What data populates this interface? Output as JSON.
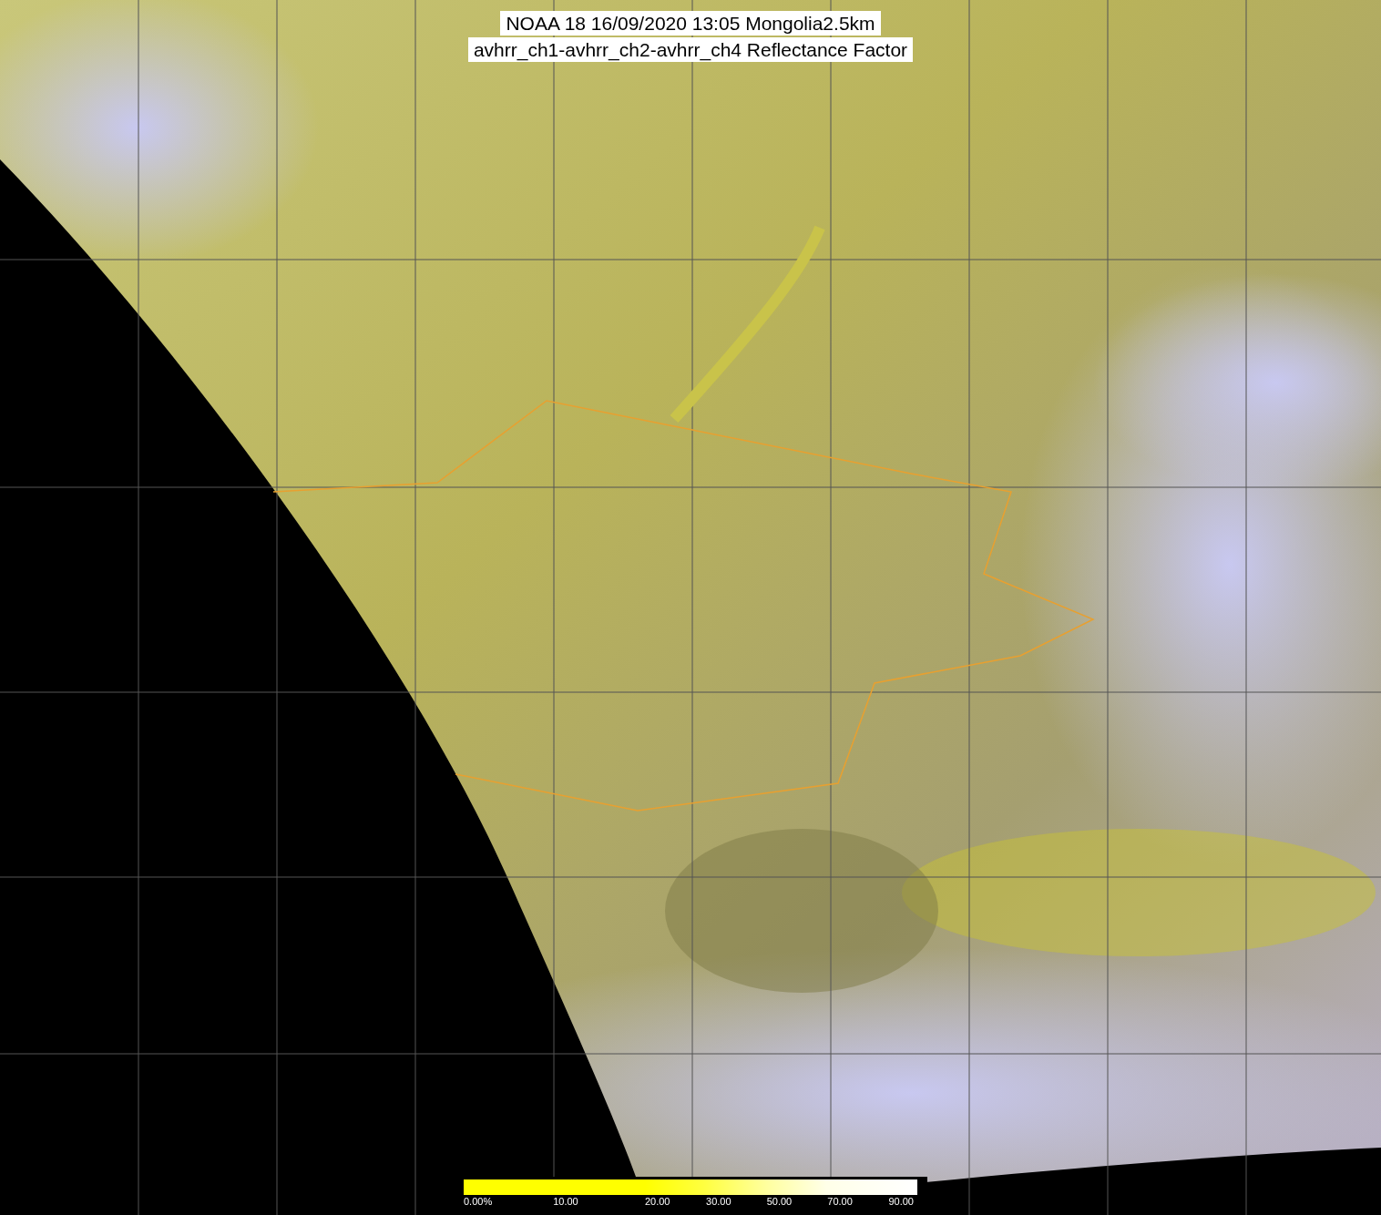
{
  "title": {
    "lines": [
      "NOAA 18 16/09/2020 13:05 Mongolia2.5km",
      "avhrr_ch1-avhrr_ch2-avhrr_ch4 Reflectance Factor"
    ]
  },
  "colorbar": {
    "labels": [
      "0.00%",
      "10.00",
      "20.00",
      "30.00",
      "50.00",
      "70.00",
      "90.00"
    ]
  }
}
